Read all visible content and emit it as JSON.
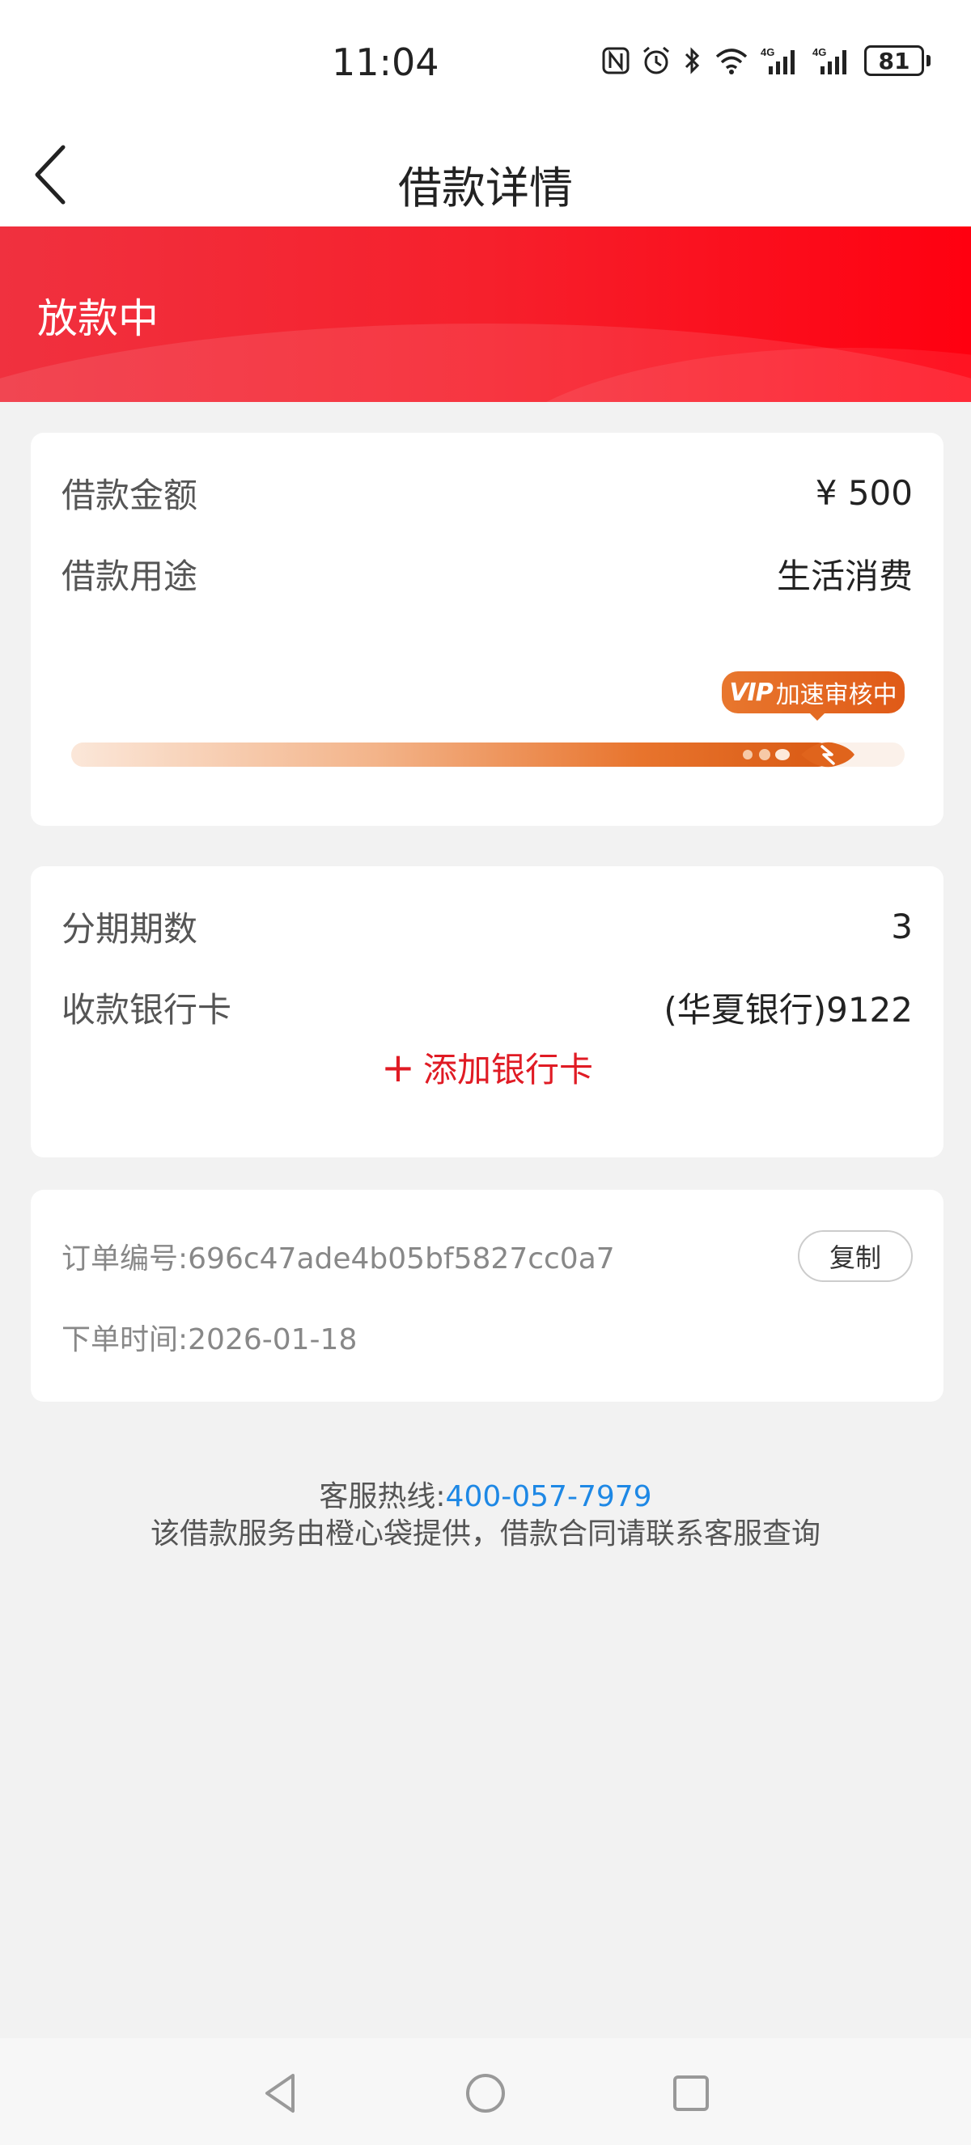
{
  "status_bar": {
    "time": "11:04",
    "battery": "81",
    "icons": [
      "nfc-icon",
      "alarm-icon",
      "bluetooth-icon",
      "wifi-icon",
      "signal-4g-icon",
      "signal-4g-icon",
      "battery-icon"
    ]
  },
  "nav": {
    "title": "借款详情",
    "back_icon": "chevron-left-icon"
  },
  "hero": {
    "status": "放款中",
    "colors": {
      "start": "#f0313f",
      "end": "#ff0010"
    }
  },
  "loan": {
    "amount_label": "借款金额",
    "amount_value": "¥ 500",
    "purpose_label": "借款用途",
    "purpose_value": "生活消费",
    "vip_mark": "VIP",
    "vip_text": "加速审核中",
    "progress": 0.93
  },
  "repayment": {
    "installments_label": "分期期数",
    "installments_value": "3",
    "bank_card_label": "收款银行卡",
    "bank_card_value": "(华夏银行)9122",
    "add_card_icon": "+",
    "add_card_label": "添加银行卡"
  },
  "order": {
    "order_no_label": "订单编号:",
    "order_no_value": "696c47ade4b05bf5827cc0a7",
    "copy_label": "复制",
    "order_time_label": "下单时间:",
    "order_time_value": "2026-01-18"
  },
  "footer": {
    "hotline_label": "客服热线:",
    "hotline_number": "400-057-7979",
    "notice": "该借款服务由橙心袋提供，借款合同请联系客服查询"
  },
  "system_nav": {
    "icons": [
      "back-triangle-icon",
      "home-circle-icon",
      "recents-square-icon"
    ]
  },
  "colors": {
    "accent_red": "#e01b24",
    "link_blue": "#1e88e5",
    "progress_orange": "#e05a17"
  }
}
